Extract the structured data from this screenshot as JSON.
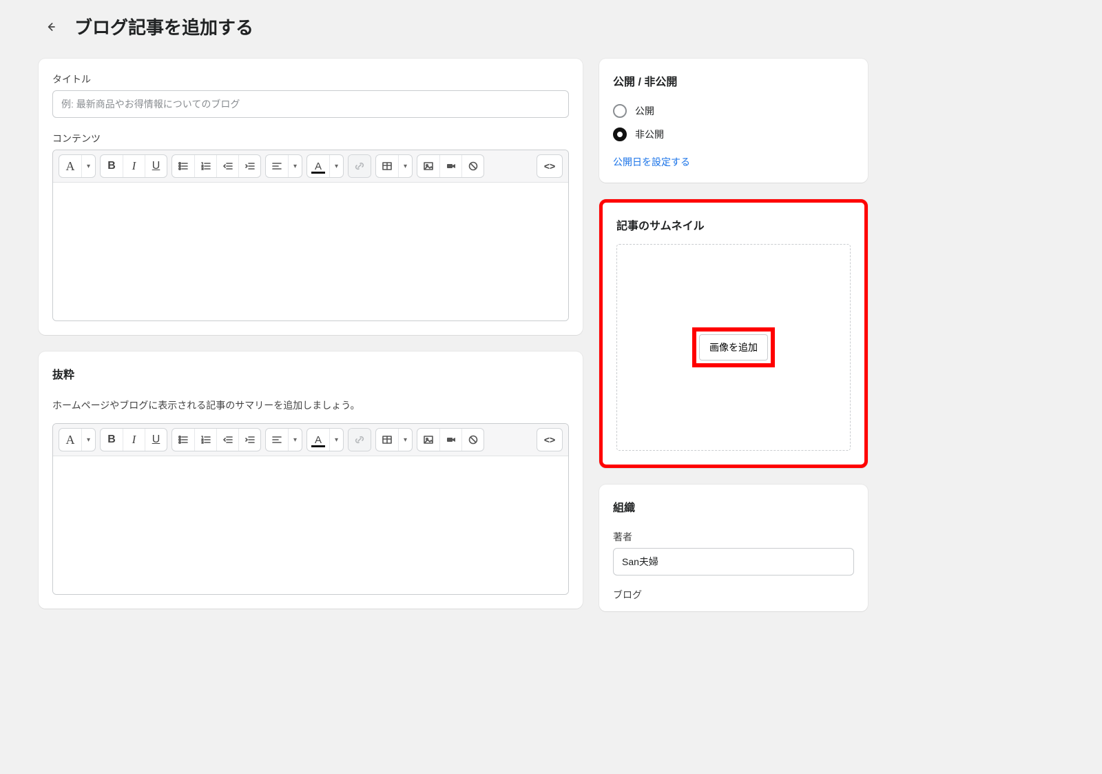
{
  "header": {
    "title": "ブログ記事を追加する"
  },
  "main": {
    "title_label": "タイトル",
    "title_placeholder": "例: 最新商品やお得情報についてのブログ",
    "title_value": "",
    "content_label": "コンテンツ",
    "excerpt_title": "抜粋",
    "excerpt_desc": "ホームページやブログに表示される記事のサマリーを追加しましょう。"
  },
  "toolbar": {
    "code_label": "<>"
  },
  "visibility": {
    "title": "公開 / 非公開",
    "options": {
      "public": "公開",
      "private": "非公開"
    },
    "selected": "private",
    "set_date_link": "公開日を設定する"
  },
  "thumbnail": {
    "title": "記事のサムネイル",
    "add_image_label": "画像を追加"
  },
  "organization": {
    "title": "組織",
    "author_label": "著者",
    "author_value": "San夫婦",
    "blog_label": "ブログ"
  }
}
